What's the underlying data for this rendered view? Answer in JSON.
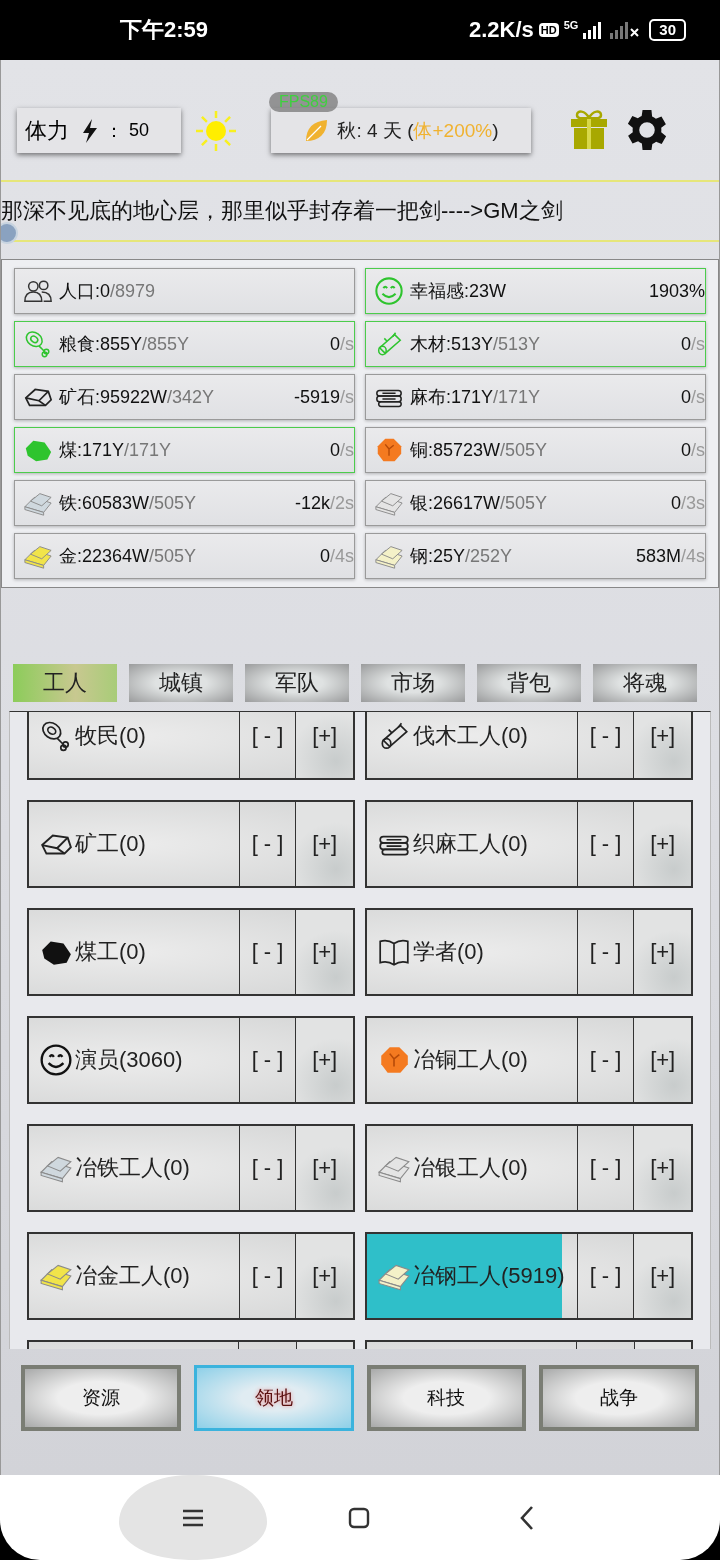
{
  "status_bar": {
    "time": "下午2:59",
    "speed": "2.2K/s",
    "hd": "HD",
    "network": "5G",
    "battery": "30"
  },
  "header": {
    "stamina": {
      "label": "体力",
      "separator": "：",
      "value": "50"
    },
    "fps": "FPS89",
    "season": {
      "day": "秋: 4 天 (",
      "bonus": "体+200%",
      "close": ")"
    }
  },
  "marquee": "那深不见底的地心层，那里似乎封存着一把剑---->GM之剑",
  "resources": [
    {
      "kind": "people",
      "amount": "人口:0",
      "capacity": "/8979",
      "highlighted": false
    },
    {
      "kind": "smile",
      "amount": "幸福感:23W",
      "rate": "1903%",
      "highlighted": true
    },
    {
      "kind": "meat",
      "amount": "粮食:855Y",
      "capacity": "/855Y",
      "rate": "0",
      "rate_unit": "/s",
      "highlighted": true
    },
    {
      "kind": "wood",
      "amount": "木材:513Y",
      "capacity": "/513Y",
      "rate": "0",
      "rate_unit": "/s",
      "highlighted": true
    },
    {
      "kind": "ore",
      "amount": "矿石:95922W",
      "capacity": "/342Y",
      "rate": "-5919",
      "rate_unit": "/s",
      "highlighted": false
    },
    {
      "kind": "cloth",
      "amount": "麻布:171Y",
      "capacity": "/171Y",
      "rate": "0",
      "rate_unit": "/s",
      "highlighted": false
    },
    {
      "kind": "coal",
      "amount": "煤:171Y",
      "capacity": "/171Y",
      "rate": "0",
      "rate_unit": "/s",
      "highlighted": true
    },
    {
      "kind": "copper",
      "amount": "铜:85723W",
      "capacity": "/505Y",
      "rate": "0",
      "rate_unit": "/s",
      "highlighted": false
    },
    {
      "kind": "iron",
      "amount": "铁:60583W",
      "capacity": "/505Y",
      "rate": "-12k",
      "rate_unit": "/2s",
      "highlighted": false
    },
    {
      "kind": "silver",
      "amount": "银:26617W",
      "capacity": "/505Y",
      "rate": "0",
      "rate_unit": "/3s",
      "highlighted": false
    },
    {
      "kind": "gold",
      "amount": "金:22364W",
      "capacity": "/505Y",
      "rate": "0",
      "rate_unit": "/4s",
      "highlighted": false
    },
    {
      "kind": "steel",
      "amount": "钢:25Y",
      "capacity": "/252Y",
      "rate": "583M",
      "rate_unit": "/4s",
      "highlighted": false
    }
  ],
  "tabs": [
    {
      "label": "工人",
      "selected": true
    },
    {
      "label": "城镇",
      "selected": false
    },
    {
      "label": "军队",
      "selected": false
    },
    {
      "label": "市场",
      "selected": false
    },
    {
      "label": "背包",
      "selected": false
    },
    {
      "label": "将魂",
      "selected": false
    }
  ],
  "workers": [
    {
      "kind": "meat",
      "label": "牧民(0)"
    },
    {
      "kind": "wood",
      "label": "伐木工人(0)"
    },
    {
      "kind": "ore",
      "label": "矿工(0)"
    },
    {
      "kind": "cloth",
      "label": "织麻工人(0)"
    },
    {
      "kind": "coal",
      "label": "煤工(0)"
    },
    {
      "kind": "book",
      "label": "学者(0)"
    },
    {
      "kind": "smile",
      "label": "演员(3060)"
    },
    {
      "kind": "copper",
      "label": "冶铜工人(0)"
    },
    {
      "kind": "iron",
      "label": "冶铁工人(0)"
    },
    {
      "kind": "silver",
      "label": "冶银工人(0)"
    },
    {
      "kind": "gold",
      "label": "冶金工人(0)"
    },
    {
      "kind": "steel",
      "label": "冶钢工人(5919)",
      "level": 0.93
    }
  ],
  "worker_buttons": {
    "minus": "[ - ]",
    "plus": "[+]"
  },
  "bottom_nav": [
    {
      "label": "资源",
      "selected": false
    },
    {
      "label": "领地",
      "selected": true
    },
    {
      "label": "科技",
      "selected": false
    },
    {
      "label": "战争",
      "selected": false
    }
  ]
}
